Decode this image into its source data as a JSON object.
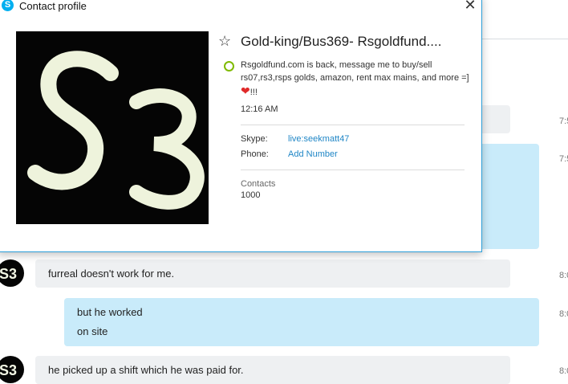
{
  "dialog": {
    "title": "Contact profile",
    "close_glyph": "✕",
    "app_icon_glyph": "S",
    "photo_icon": "profile-photo-s3",
    "favorite_glyph": "☆",
    "display_name": "Gold-king/Bus369- Rsgoldfund....",
    "mood_text": "Rsgoldfund.com is back, message me to buy/sell rs07,rs3,rsps golds, amazon, rent max mains, and more =]",
    "mood_heart": "❤",
    "mood_suffix": "!!!",
    "local_time": "12:16 AM",
    "skype_label": "Skype:",
    "skype_value": "live:seekmatt47",
    "phone_label": "Phone:",
    "phone_action": "Add Number",
    "contacts_label": "Contacts",
    "contacts_count": "1000"
  },
  "chat": {
    "messages": [
      {
        "text": "furreal doesn't work for me.",
        "time": "8:0"
      },
      {
        "line1": "but he worked",
        "line2": "on site",
        "time": "8:0"
      },
      {
        "text": "he picked up a shift which he was paid for.",
        "time": "8:0"
      }
    ],
    "earlier_times": [
      "7:5",
      "7:5"
    ]
  },
  "colors": {
    "accent": "#2d9fd9",
    "outgoing_bubble": "#c9ebfa",
    "incoming_bubble": "#eef0f2",
    "link": "#1f86c6",
    "presence_online": "#7fba00"
  }
}
